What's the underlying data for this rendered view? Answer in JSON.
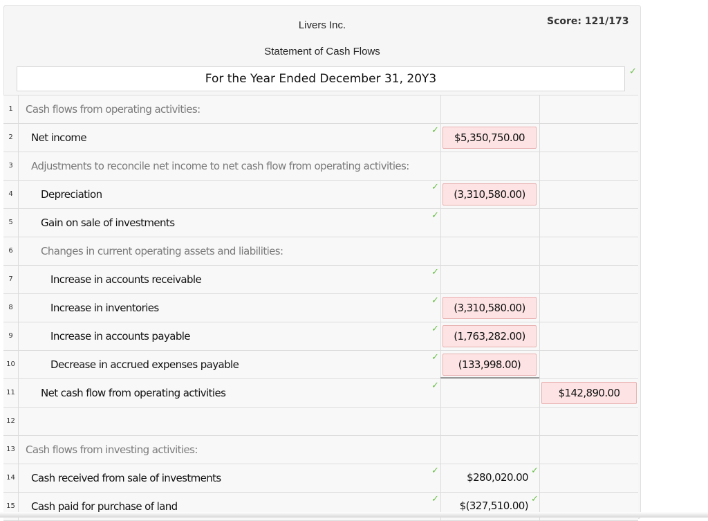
{
  "header": {
    "company": "Livers Inc.",
    "statement": "Statement of Cash Flows",
    "period": "For the Year Ended December 31, 20Y3",
    "score": "Score: 121/173"
  },
  "check_glyph": "✓",
  "rows": [
    {
      "num": "1",
      "label": "Cash flows from operating activities:",
      "muted": true,
      "indent": 0,
      "col1": "",
      "col2": ""
    },
    {
      "num": "2",
      "label": "Net income",
      "muted": false,
      "indent": 1,
      "col1": "$5,350,750.00",
      "col1_state": "incorrect",
      "col2": ""
    },
    {
      "num": "3",
      "label": "Adjustments to reconcile net income to net cash flow from operating activities:",
      "muted": true,
      "indent": 1,
      "col1": "",
      "col2": ""
    },
    {
      "num": "4",
      "label": "Depreciation",
      "muted": false,
      "indent": 2,
      "col1": "(3,310,580.00)",
      "col1_state": "incorrect",
      "col2": ""
    },
    {
      "num": "5",
      "label": "Gain on sale of investments",
      "muted": false,
      "indent": 2,
      "col1": "",
      "col2": ""
    },
    {
      "num": "6",
      "label": "Changes in current operating assets and liabilities:",
      "muted": true,
      "indent": 2,
      "col1": "",
      "col2": ""
    },
    {
      "num": "7",
      "label": "Increase in accounts receivable",
      "muted": false,
      "indent": 3,
      "col1": "",
      "col2": ""
    },
    {
      "num": "8",
      "label": "Increase in inventories",
      "muted": false,
      "indent": 3,
      "col1": "(3,310,580.00)",
      "col1_state": "incorrect",
      "col2": ""
    },
    {
      "num": "9",
      "label": "Increase in accounts payable",
      "muted": false,
      "indent": 3,
      "col1": "(1,763,282.00)",
      "col1_state": "incorrect",
      "col2": ""
    },
    {
      "num": "10",
      "label": "Decrease in accrued expenses payable",
      "muted": false,
      "indent": 3,
      "col1": "(133,998.00)",
      "col1_state": "incorrect",
      "col2": ""
    },
    {
      "num": "11",
      "label": "Net cash flow from operating activities",
      "muted": false,
      "indent": 2,
      "col1": "",
      "col2": "$142,890.00",
      "col2_state": "incorrect"
    },
    {
      "num": "12",
      "label": "",
      "muted": false,
      "indent": 0,
      "col1": "",
      "col2": ""
    },
    {
      "num": "13",
      "label": "Cash flows from investing activities:",
      "muted": true,
      "indent": 0,
      "col1": "",
      "col2": ""
    },
    {
      "num": "14",
      "label": "Cash received from sale of investments",
      "muted": false,
      "indent": 1,
      "col1": "$280,020.00",
      "col1_state": "correct",
      "col2": ""
    },
    {
      "num": "15",
      "label": "Cash paid for purchase of land",
      "muted": false,
      "indent": 1,
      "col1": "$(327,510.00)",
      "col1_state": "correct",
      "col2": ""
    }
  ],
  "colors": {
    "correct_check": "#6cc04a",
    "incorrect_fill": "#fde3e3",
    "incorrect_border": "#e8b0b0"
  }
}
